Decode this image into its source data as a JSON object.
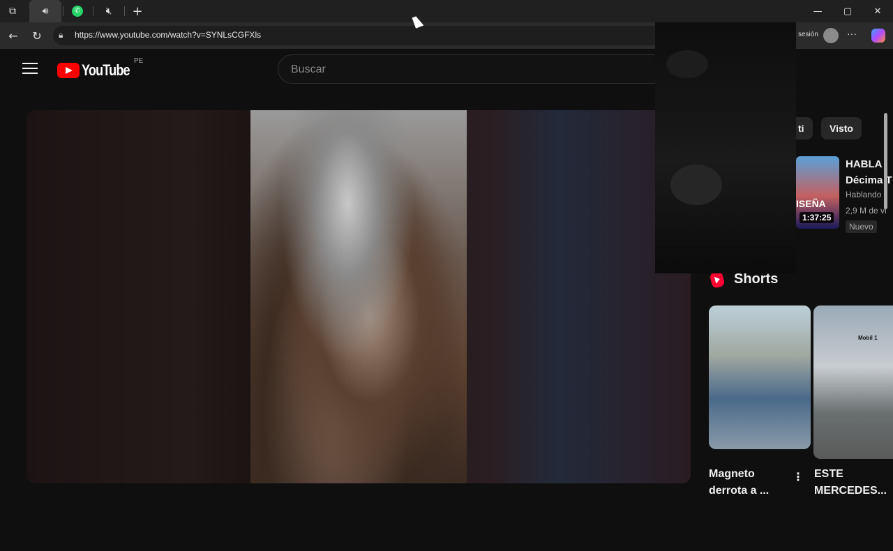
{
  "browser": {
    "tab_icons": [
      "tab-actions-icon",
      "audio-playing-icon",
      "whatsapp-icon",
      "muted-audio-icon",
      "new-tab-icon"
    ],
    "url": "https://www.youtube.com/watch?v=SYNLsCGFXls",
    "signin_partial": "sesión",
    "window_controls": {
      "minimize": "—",
      "maximize": "▢",
      "close": "✕"
    }
  },
  "youtube": {
    "logo_text": "YouTube",
    "region": "PE",
    "search_placeholder": "Buscar"
  },
  "filters": {
    "chip_partial": "ti",
    "chip_visto": "Visto"
  },
  "recommended": {
    "thumb_word": "ISEÑA",
    "duration": "1:37:25",
    "title_line1": "HABLA",
    "title_line2": "Décima T",
    "channel": "Hablando",
    "views": "2,9 M de vi",
    "badge": "Nuevo"
  },
  "shorts": {
    "heading": "Shorts",
    "items": [
      {
        "title": "Magneto derrota a ..."
      },
      {
        "title": "ESTE MERCEDES..."
      }
    ],
    "short2_logo": "Mobil 1"
  },
  "colors": {
    "accent": "#ff0000",
    "background": "#0f0f0f"
  }
}
